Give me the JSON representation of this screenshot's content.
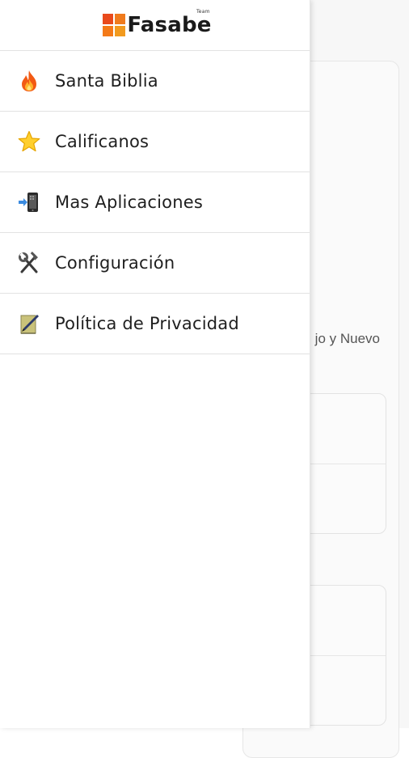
{
  "app": {
    "logo_text": "Fasabe",
    "logo_superscript": "Team"
  },
  "drawer": {
    "items": [
      {
        "label": "Santa Biblia",
        "icon": "fire-icon"
      },
      {
        "label": "Calificanos",
        "icon": "star-icon"
      },
      {
        "label": "Mas Aplicaciones",
        "icon": "mobile-arrow-icon"
      },
      {
        "label": "Configuración",
        "icon": "hammer-wrench-icon"
      },
      {
        "label": "Política de Privacidad",
        "icon": "pen-paper-icon"
      }
    ]
  },
  "background": {
    "description_fragment": "jo y Nuevo"
  },
  "colors": {
    "logo_red": "#e94a1c",
    "logo_orange": "#f07b1d",
    "drawer_bg": "#ffffff",
    "divider": "#e2e2e2"
  }
}
